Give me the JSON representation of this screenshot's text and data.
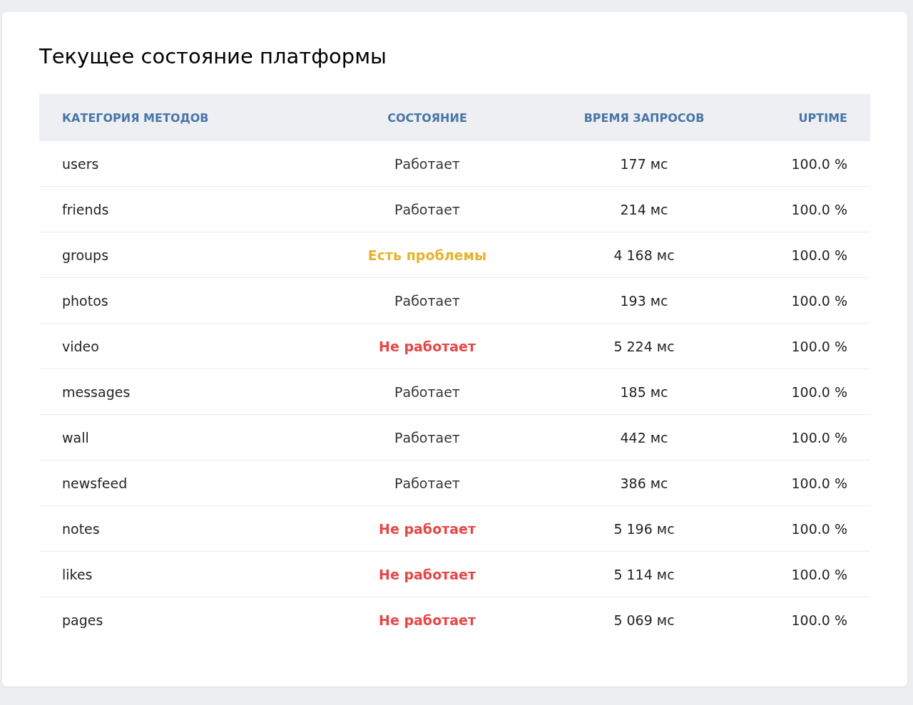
{
  "title": "Текущее состояние платформы",
  "table": {
    "columns": [
      "КАТЕГОРИЯ МЕТОДОВ",
      "СОСТОЯНИЕ",
      "ВРЕМЯ ЗАПРОСОВ",
      "UPTIME"
    ],
    "rows": [
      {
        "category": "users",
        "status": "Работает",
        "kind": "ok",
        "time": "177 мс",
        "uptime": "100.0 %"
      },
      {
        "category": "friends",
        "status": "Работает",
        "kind": "ok",
        "time": "214 мс",
        "uptime": "100.0 %"
      },
      {
        "category": "groups",
        "status": "Есть проблемы",
        "kind": "warning",
        "time": "4 168 мс",
        "uptime": "100.0 %"
      },
      {
        "category": "photos",
        "status": "Работает",
        "kind": "ok",
        "time": "193 мс",
        "uptime": "100.0 %"
      },
      {
        "category": "video",
        "status": "Не работает",
        "kind": "down",
        "time": "5 224 мс",
        "uptime": "100.0 %"
      },
      {
        "category": "messages",
        "status": "Работает",
        "kind": "ok",
        "time": "185 мс",
        "uptime": "100.0 %"
      },
      {
        "category": "wall",
        "status": "Работает",
        "kind": "ok",
        "time": "442 мс",
        "uptime": "100.0 %"
      },
      {
        "category": "newsfeed",
        "status": "Работает",
        "kind": "ok",
        "time": "386 мс",
        "uptime": "100.0 %"
      },
      {
        "category": "notes",
        "status": "Не работает",
        "kind": "down",
        "time": "5 196 мс",
        "uptime": "100.0 %"
      },
      {
        "category": "likes",
        "status": "Не работает",
        "kind": "down",
        "time": "5 114 мс",
        "uptime": "100.0 %"
      },
      {
        "category": "pages",
        "status": "Не работает",
        "kind": "down",
        "time": "5 069 мс",
        "uptime": "100.0 %"
      }
    ]
  }
}
